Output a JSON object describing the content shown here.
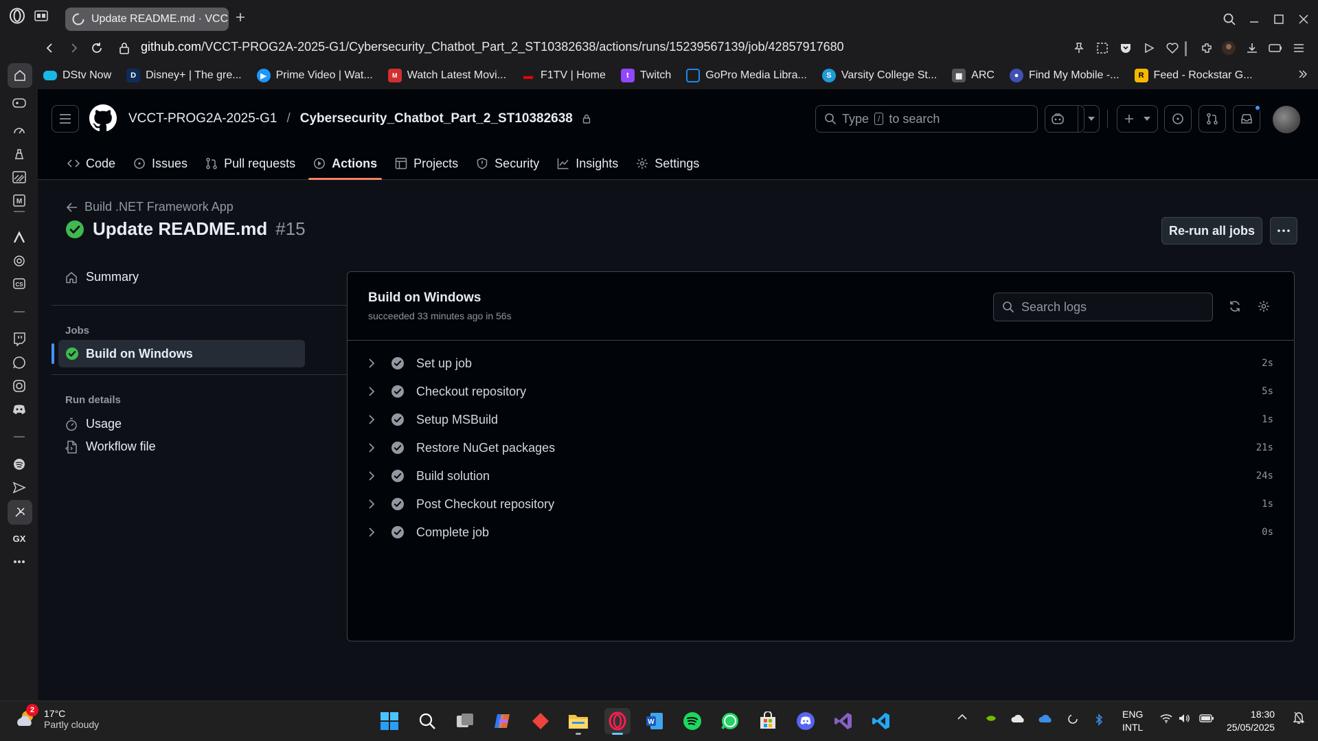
{
  "browser": {
    "tab_title": "Update README.md · VCC",
    "url_host": "github.com",
    "url_path": "/VCCT-PROG2A-2025-G1/Cybersecurity_Chatbot_Part_2_ST10382638/actions/runs/15239567139/job/42857917680",
    "bookmarks": [
      {
        "label": "DStv Now",
        "icon_color": "#19b6e8"
      },
      {
        "label": "Disney+ | The gre...",
        "icon_color": "#0f2b5a"
      },
      {
        "label": "Prime Video | Wat...",
        "icon_color": "#1a98ff"
      },
      {
        "label": "Watch Latest Movi...",
        "icon_color": "#d32f2f"
      },
      {
        "label": "F1TV | Home",
        "icon_color": "#e10600"
      },
      {
        "label": "Twitch",
        "icon_color": "#9146ff"
      },
      {
        "label": "GoPro Media Libra...",
        "icon_color": "#1e88e5"
      },
      {
        "label": "Varsity College St...",
        "icon_color": "#1f9bd7"
      },
      {
        "label": "ARC",
        "icon_color": "#555555"
      },
      {
        "label": "Find My Mobile -...",
        "icon_color": "#3f51b5"
      },
      {
        "label": "Feed - Rockstar G...",
        "icon_color": "#f5b700"
      }
    ]
  },
  "github": {
    "owner": "VCCT-PROG2A-2025-G1",
    "repo": "Cybersecurity_Chatbot_Part_2_ST10382638",
    "search_prefix": "Type",
    "search_key": "/",
    "search_suffix": "to search",
    "nav": [
      {
        "label": "Code",
        "icon": "code-icon"
      },
      {
        "label": "Issues",
        "icon": "issue-icon"
      },
      {
        "label": "Pull requests",
        "icon": "pull-request-icon"
      },
      {
        "label": "Actions",
        "icon": "play-icon"
      },
      {
        "label": "Projects",
        "icon": "table-icon"
      },
      {
        "label": "Security",
        "icon": "shield-icon"
      },
      {
        "label": "Insights",
        "icon": "graph-icon"
      },
      {
        "label": "Settings",
        "icon": "gear-icon"
      }
    ],
    "active_nav": "Actions",
    "workflow_link": "Build .NET Framework App",
    "run_title": "Update README.md",
    "run_number": "#15",
    "rerun_label": "Re-run all jobs",
    "sidebar": {
      "summary": "Summary",
      "jobs_heading": "Jobs",
      "job": "Build on Windows",
      "run_details_heading": "Run details",
      "usage": "Usage",
      "workflow_file": "Workflow file"
    },
    "job_panel": {
      "title": "Build on Windows",
      "subtitle": "succeeded 33 minutes ago in 56s",
      "search_placeholder": "Search logs",
      "steps": [
        {
          "name": "Set up job",
          "duration": "2s"
        },
        {
          "name": "Checkout repository",
          "duration": "5s"
        },
        {
          "name": "Setup MSBuild",
          "duration": "1s"
        },
        {
          "name": "Restore NuGet packages",
          "duration": "21s"
        },
        {
          "name": "Build solution",
          "duration": "24s"
        },
        {
          "name": "Post Checkout repository",
          "duration": "1s"
        },
        {
          "name": "Complete job",
          "duration": "0s"
        }
      ]
    }
  },
  "taskbar": {
    "weather_temp": "17°C",
    "weather_cond": "Partly cloudy",
    "weather_badge": "2",
    "lang_top": "ENG",
    "lang_bottom": "INTL",
    "time": "18:30",
    "date": "25/05/2025"
  },
  "colors": {
    "success": "#3fb950",
    "accent_underline": "#f78166",
    "selected_bar": "#4493f8"
  }
}
